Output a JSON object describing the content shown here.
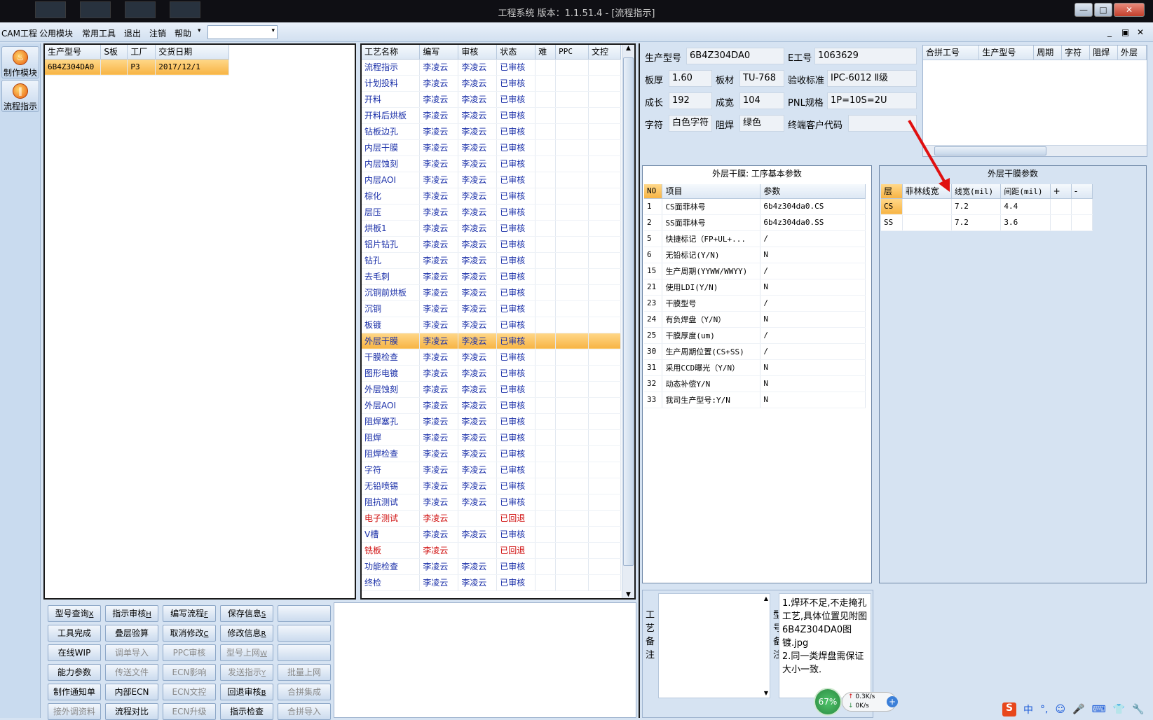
{
  "window": {
    "title": "工程系统   版本：1.1.51.4 - [流程指示]",
    "min": "—",
    "max": "□",
    "close": "✕"
  },
  "menu": {
    "items": [
      "CAM工程",
      "公用模块",
      "常用工具",
      "退出",
      "注销",
      "帮助"
    ],
    "combo_arrow": "▾",
    "mdi": [
      "_",
      "▣",
      "✕"
    ]
  },
  "leftbar": [
    {
      "label": "制作模块",
      "icon": "fire-icon"
    },
    {
      "label": "流程指示",
      "icon": "pause-icon"
    }
  ],
  "orders": {
    "headers": [
      "生产型号",
      "S板",
      "工厂",
      "交货日期"
    ],
    "rows": [
      [
        "6B4Z304DA0",
        "",
        "P3",
        "2017/12/1"
      ]
    ]
  },
  "process": {
    "headers": [
      "工艺名称",
      "编写",
      "审核",
      "状态",
      "难",
      "PPC",
      "文控"
    ],
    "rows": [
      [
        "流程指示",
        "李凌云",
        "李凌云",
        "已审核"
      ],
      [
        "计划投料",
        "李凌云",
        "李凌云",
        "已审核"
      ],
      [
        "开料",
        "李凌云",
        "李凌云",
        "已审核"
      ],
      [
        "开料后烘板",
        "李凌云",
        "李凌云",
        "已审核"
      ],
      [
        "钻板边孔",
        "李凌云",
        "李凌云",
        "已审核"
      ],
      [
        "内层干膜",
        "李凌云",
        "李凌云",
        "已审核"
      ],
      [
        "内层蚀刻",
        "李凌云",
        "李凌云",
        "已审核"
      ],
      [
        "内层AOI",
        "李凌云",
        "李凌云",
        "已审核"
      ],
      [
        "棕化",
        "李凌云",
        "李凌云",
        "已审核"
      ],
      [
        "层压",
        "李凌云",
        "李凌云",
        "已审核"
      ],
      [
        "烘板1",
        "李凌云",
        "李凌云",
        "已审核"
      ],
      [
        "铝片钻孔",
        "李凌云",
        "李凌云",
        "已审核"
      ],
      [
        "钻孔",
        "李凌云",
        "李凌云",
        "已审核"
      ],
      [
        "去毛刺",
        "李凌云",
        "李凌云",
        "已审核"
      ],
      [
        "沉铜前烘板",
        "李凌云",
        "李凌云",
        "已审核"
      ],
      [
        "沉铜",
        "李凌云",
        "李凌云",
        "已审核"
      ],
      [
        "板镀",
        "李凌云",
        "李凌云",
        "已审核"
      ],
      [
        "外层干膜",
        "李凌云",
        "李凌云",
        "已审核"
      ],
      [
        "干膜检查",
        "李凌云",
        "李凌云",
        "已审核"
      ],
      [
        "图形电镀",
        "李凌云",
        "李凌云",
        "已审核"
      ],
      [
        "外层蚀刻",
        "李凌云",
        "李凌云",
        "已审核"
      ],
      [
        "外层AOI",
        "李凌云",
        "李凌云",
        "已审核"
      ],
      [
        "阻焊塞孔",
        "李凌云",
        "李凌云",
        "已审核"
      ],
      [
        "阻焊",
        "李凌云",
        "李凌云",
        "已审核"
      ],
      [
        "阻焊检查",
        "李凌云",
        "李凌云",
        "已审核"
      ],
      [
        "字符",
        "李凌云",
        "李凌云",
        "已审核"
      ],
      [
        "无铅喷锡",
        "李凌云",
        "李凌云",
        "已审核"
      ],
      [
        "阻抗测试",
        "李凌云",
        "李凌云",
        "已审核"
      ],
      [
        "电子测试",
        "李凌云",
        "",
        "已回退"
      ],
      [
        "V槽",
        "李凌云",
        "李凌云",
        "已审核"
      ],
      [
        "铣板",
        "李凌云",
        "",
        "已回退"
      ],
      [
        "功能检查",
        "李凌云",
        "李凌云",
        "已审核"
      ],
      [
        "终检",
        "李凌云",
        "李凌云",
        "已审核"
      ]
    ],
    "selected_index": 17,
    "returned_indices": [
      28,
      30
    ]
  },
  "buttons": [
    {
      "label": "型号查询",
      "key": "X",
      "enabled": true
    },
    {
      "label": "指示审核",
      "key": "H",
      "enabled": true
    },
    {
      "label": "编写流程",
      "key": "F",
      "enabled": true
    },
    {
      "label": "保存信息",
      "key": "S",
      "enabled": true
    },
    {
      "label": "",
      "key": "",
      "enabled": true
    },
    {
      "label": "工具完成",
      "key": "",
      "enabled": true
    },
    {
      "label": "叠层验算",
      "key": "",
      "enabled": true
    },
    {
      "label": "取消修改",
      "key": "C",
      "enabled": true
    },
    {
      "label": "修改信息",
      "key": "R",
      "enabled": true
    },
    {
      "label": "",
      "key": "",
      "enabled": true
    },
    {
      "label": "在线WIP",
      "key": "",
      "enabled": true
    },
    {
      "label": "调单导入",
      "key": "",
      "enabled": false
    },
    {
      "label": "PPC审核",
      "key": "",
      "enabled": false
    },
    {
      "label": "型号上网",
      "key": "W",
      "enabled": false
    },
    {
      "label": "",
      "key": "",
      "enabled": true
    },
    {
      "label": "能力参数",
      "key": "",
      "enabled": true
    },
    {
      "label": "传送文件",
      "key": "",
      "enabled": false
    },
    {
      "label": "ECN影响",
      "key": "",
      "enabled": false
    },
    {
      "label": "发送指示",
      "key": "Y",
      "enabled": false
    },
    {
      "label": "批量上网",
      "key": "",
      "enabled": false
    },
    {
      "label": "制作通知单",
      "key": "",
      "enabled": true
    },
    {
      "label": "内部ECN",
      "key": "",
      "enabled": true
    },
    {
      "label": "ECN文控",
      "key": "",
      "enabled": false
    },
    {
      "label": "回退审核",
      "key": "B",
      "enabled": true
    },
    {
      "label": "合拼集成",
      "key": "",
      "enabled": false
    },
    {
      "label": "接外调资料",
      "key": "",
      "enabled": false
    },
    {
      "label": "流程对比",
      "key": "",
      "enabled": true
    },
    {
      "label": "ECN升级",
      "key": "",
      "enabled": false
    },
    {
      "label": "指示检查",
      "key": "",
      "enabled": true
    },
    {
      "label": "合拼导入",
      "key": "",
      "enabled": false
    }
  ],
  "info": {
    "model_label": "生产型号",
    "model": "6B4Z304DA0",
    "eno_label": "E工号",
    "eno": "1063629",
    "thick_label": "板厚",
    "thick": "1.60",
    "mat_label": "板材",
    "mat": "TU-768",
    "std_label": "验收标准",
    "std": "IPC-6012 Ⅱ级",
    "len_label": "成长",
    "len": "192",
    "wid_label": "成宽",
    "wid": "104",
    "pnl_label": "PNL规格",
    "pnl": "1P=10S=2U",
    "char_label": "字符",
    "char": "白色字符",
    "mask_label": "阻焊",
    "mask": "绿色",
    "cust_label": "终端客户代码",
    "cust": ""
  },
  "merge": {
    "headers": [
      "合拼工号",
      "生产型号",
      "周期",
      "字符",
      "阻焊",
      "外层"
    ]
  },
  "params": {
    "title": "外层干膜: 工序基本参数",
    "headers": [
      "NO",
      "项目",
      "参数"
    ],
    "rows": [
      [
        "1",
        "CS面菲林号",
        "6b4z304da0.CS"
      ],
      [
        "2",
        "SS面菲林号",
        "6b4z304da0.SS"
      ],
      [
        "5",
        "快捷标记（FP+UL+...",
        "/"
      ],
      [
        "6",
        "无铅标记(Y/N)",
        "N"
      ],
      [
        "15",
        "生产周期(YYWW/WWYY)",
        "/"
      ],
      [
        "21",
        "使用LDI(Y/N)",
        "N"
      ],
      [
        "23",
        "干膜型号",
        "/"
      ],
      [
        "24",
        "有负焊盘（Y/N）",
        "N"
      ],
      [
        "25",
        "干膜厚度(um)",
        "/"
      ],
      [
        "30",
        "生产周期位置(CS+SS)",
        "/"
      ],
      [
        "31",
        "采用CCD曝光（Y/N）",
        "N"
      ],
      [
        "32",
        "动态补偿Y/N",
        "N"
      ],
      [
        "33",
        "我司生产型号:Y/N",
        "N"
      ]
    ]
  },
  "film": {
    "title": "外层干膜参数",
    "headers": [
      "层",
      "菲林线宽",
      "线宽(mil)",
      "间距(mil)",
      "+",
      "-"
    ],
    "rows": [
      [
        "CS",
        "",
        "7.2",
        "4.4",
        "",
        ""
      ],
      [
        "SS",
        "",
        "7.2",
        "3.6",
        "",
        ""
      ]
    ]
  },
  "remarks": {
    "process_label": "工艺备注",
    "model_label": "型号备注",
    "model_text": "1.焊环不足,不走掩孔工艺,具体位置见附图6B4Z304DA0图镀.jpg\n2.同一类焊盘需保证大小一致."
  },
  "net": {
    "percent": "67%",
    "up": "0.3K/s",
    "down": "0K/s"
  },
  "tray": [
    "中",
    "°,",
    "☺",
    "🎤",
    "⌨",
    "👕",
    "🔧"
  ],
  "colors": {
    "selected_row": "#f7b445",
    "process_text": "#1a2fa8",
    "returned": "#d01010",
    "annotation_arrow": "#e01010"
  }
}
